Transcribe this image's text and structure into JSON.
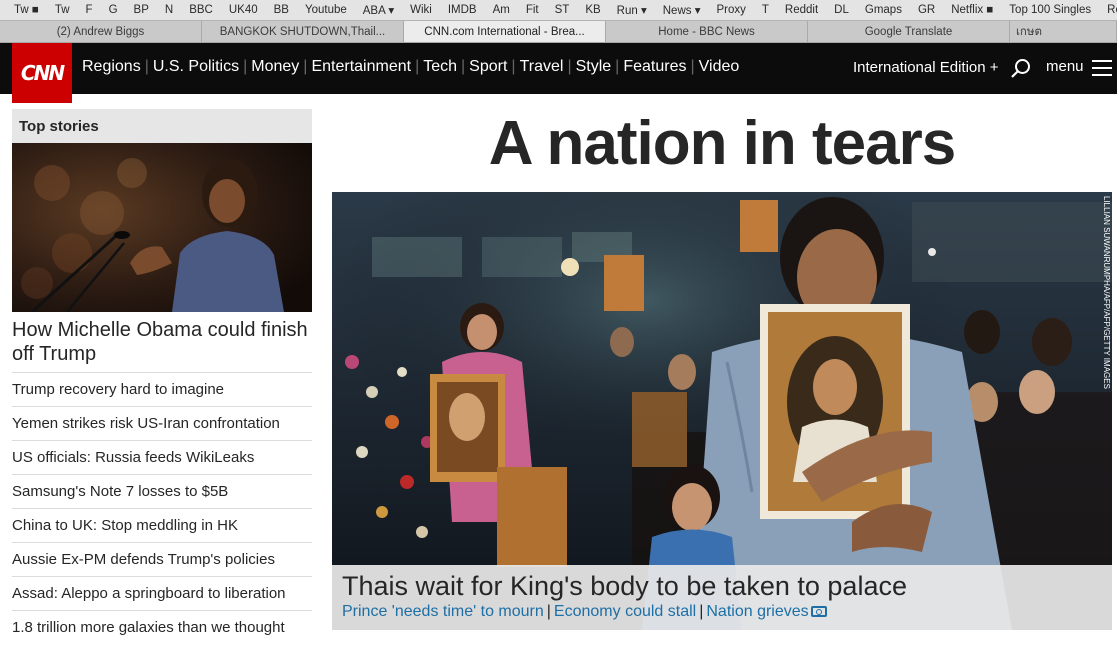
{
  "browser": {
    "bookmarks": [
      "Tw ■",
      "Tw",
      "F",
      "G",
      "BP",
      "N",
      "BBC",
      "UK40",
      "BB",
      "Youtube",
      "ABA ▾",
      "Wiki",
      "IMDB",
      "Am",
      "Fit",
      "ST",
      "KB",
      "Run ▾",
      "News ▾",
      "Proxy",
      "T",
      "Reddit",
      "DL",
      "Gmaps",
      "GR",
      "Netflix ■",
      "Top 100 Singles",
      "Re"
    ],
    "tabs": [
      "(2) Andrew Biggs",
      "BANGKOK SHUTDOWN,Thail...",
      "CNN.com International - Brea...",
      "Home - BBC News",
      "Google Translate",
      "เกษต"
    ]
  },
  "header": {
    "logo": "CNN",
    "nav": [
      "Regions",
      "U.S. Politics",
      "Money",
      "Entertainment",
      "Tech",
      "Sport",
      "Travel",
      "Style",
      "Features",
      "Video"
    ],
    "edition": "International Edition +",
    "menu_label": "menu",
    "icons": {
      "search": "search-icon",
      "menu": "hamburger-icon"
    }
  },
  "sidebar": {
    "section_title": "Top stories",
    "lead_headline": "How Michelle Obama could finish off Trump",
    "stories": [
      "Trump recovery hard to imagine",
      "Yemen strikes risk US-Iran confrontation",
      "US officials: Russia feeds WikiLeaks",
      "Samsung's Note 7 losses to $5B",
      "China to UK: Stop meddling in HK",
      "Aussie Ex-PM defends Trump's policies",
      "Assad: Aleppo a springboard to liberation",
      "1.8 trillion more galaxies than we thought"
    ]
  },
  "main": {
    "title": "A nation in tears",
    "caption_headline": "Thais wait for King's body to be taken to palace",
    "links": [
      "Prince 'needs time' to mourn",
      "Economy could stall",
      "Nation grieves"
    ],
    "photo_credit": "LILLIAN SUWANRUMPHA/AFP/AFP/GETTY IMAGES"
  },
  "colors": {
    "cnn_red": "#cc0000",
    "header_bg": "#0c0c0c",
    "link_blue": "#1d6fa5"
  }
}
